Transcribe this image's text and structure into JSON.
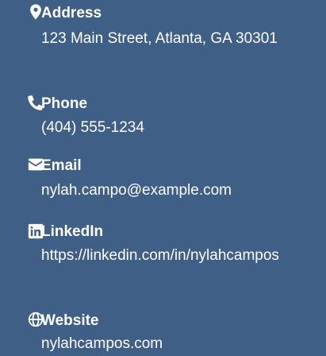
{
  "colors": {
    "background": "#3f5f86",
    "text": "#ffffff"
  },
  "contacts": [
    {
      "icon": "map-marker-icon",
      "label": "Address",
      "value": "123 Main Street, Atlanta, GA 30301"
    },
    {
      "icon": "phone-icon",
      "label": "Phone",
      "value": "(404) 555-1234"
    },
    {
      "icon": "envelope-icon",
      "label": "Email",
      "value": "nylah.campo@example.com"
    },
    {
      "icon": "linkedin-icon",
      "label": "LinkedIn",
      "value": "https://linkedin.com/in/nylahcampos"
    },
    {
      "icon": "globe-icon",
      "label": "Website",
      "value": "nylahcampos.com"
    }
  ]
}
